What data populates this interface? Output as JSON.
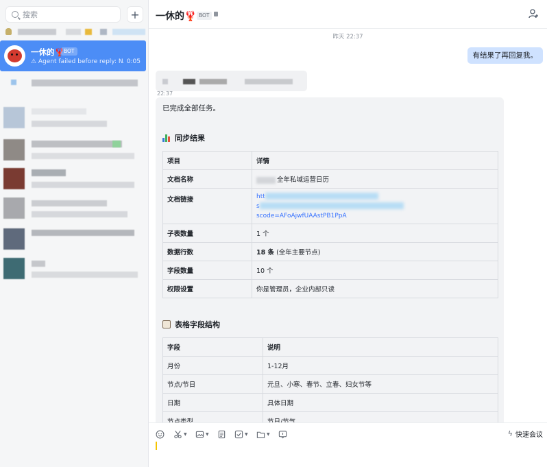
{
  "sidebar": {
    "search_placeholder": "搜索",
    "add_label": "+",
    "active_conversation": {
      "name": "一休的🦞",
      "tag": "BOT",
      "preview": "⚠ Agent failed before reply: N...",
      "time": "0:05"
    }
  },
  "header": {
    "title": "一休的",
    "title_emoji": "🦞",
    "tag": "BOT"
  },
  "chat": {
    "date_separator": "昨天 22:37",
    "my_message": "有结果了再回复我。",
    "bot_time": "22:37",
    "bot_message": {
      "intro": "已完成全部任务。",
      "sync_section_title": "同步结果",
      "sync_table": {
        "headers": [
          "项目",
          "详情"
        ],
        "rows": [
          {
            "k": "文档名称",
            "v": "全年私域运营日历"
          },
          {
            "k": "文档链接",
            "link1": "htt",
            "link2": "s",
            "link3": "scode=AFoAjwfUAAstPB1PpA"
          },
          {
            "k": "子表数量",
            "v": "1 个"
          },
          {
            "k": "数据行数",
            "v_bold": "18 条",
            "v_rest": "(全年主要节点)"
          },
          {
            "k": "字段数量",
            "v": "10 个"
          },
          {
            "k": "权限设置",
            "v": "你是管理员，企业内部只读"
          }
        ]
      },
      "fields_section_title": "表格字段结构",
      "fields_table": {
        "headers": [
          "字段",
          "说明"
        ],
        "rows": [
          {
            "k": "月份",
            "v": "1-12月"
          },
          {
            "k": "节点/节日",
            "v": "元旦、小寒、春节、立春、妇女节等"
          },
          {
            "k": "日期",
            "v": "具体日期"
          },
          {
            "k": "节点类型",
            "v": "节日/节气"
          }
        ]
      }
    }
  },
  "composer": {
    "quick_meeting": "快速会议"
  },
  "colors": {
    "active_conversation_bg": "#4c8df6",
    "my_bubble_bg": "#cfe2ff",
    "bot_bubble_bg": "#f2f3f5",
    "link": "#3370ff"
  }
}
